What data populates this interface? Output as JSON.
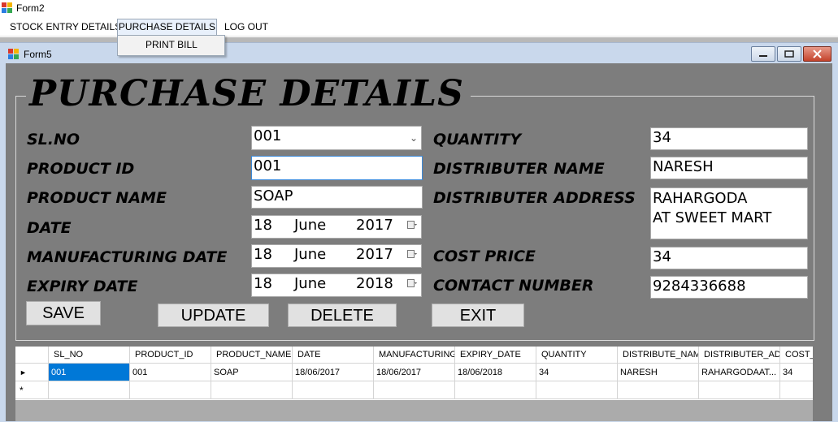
{
  "window": {
    "title": "Form2"
  },
  "menu": {
    "items": [
      "STOCK ENTRY DETAILS",
      "PURCHASE DETAILS",
      "LOG OUT"
    ],
    "dropdown": [
      "PRINT BILL"
    ]
  },
  "child": {
    "title": "Form5"
  },
  "form": {
    "heading": "PURCHASE DETAILS",
    "labels": {
      "sl_no": "SL.NO",
      "product_id": "PRODUCT ID",
      "product_name": "PRODUCT NAME",
      "date": "DATE",
      "manufacturing_date": "MANUFACTURING DATE",
      "expiry_date": "EXPIRY DATE",
      "quantity": "QUANTITY",
      "distributer_name": "DISTRIBUTER NAME",
      "distributer_address": "DISTRIBUTER ADDRESS",
      "cost_price": "COST PRICE",
      "contact_number": "CONTACT NUMBER"
    },
    "values": {
      "sl_no": "001",
      "product_id": "001",
      "product_name": "SOAP",
      "date": {
        "day": "18",
        "month": "June",
        "year": "2017"
      },
      "manufacturing_date": {
        "day": "18",
        "month": "June",
        "year": "2017"
      },
      "expiry_date": {
        "day": "18",
        "month": "June",
        "year": "2018"
      },
      "quantity": "34",
      "distributer_name": "NARESH",
      "distributer_address_line1": "RAHARGODA",
      "distributer_address_line2": "AT SWEET MART",
      "cost_price": "34",
      "contact_number": "9284336688"
    },
    "buttons": {
      "save": "SAVE",
      "update": "UPDATE",
      "delete": "DELETE",
      "exit": "EXIT"
    }
  },
  "grid": {
    "columns": [
      "SL_NO",
      "PRODUCT_ID",
      "PRODUCT_NAME",
      "DATE",
      "MANUFACTURING",
      "EXPIRY_DATE",
      "QUANTITY",
      "DISTRIBUTE_NAM",
      "DISTRIBUTER_AD",
      "COST_"
    ],
    "rows": [
      [
        "001",
        "001",
        "SOAP",
        "18/06/2017",
        "18/06/2017",
        "18/06/2018",
        "34",
        "NARESH",
        "RAHARGODAAT...",
        "34"
      ]
    ],
    "current_row_marker": "►",
    "new_row_marker": "*",
    "selected_color": "#0078d7"
  }
}
